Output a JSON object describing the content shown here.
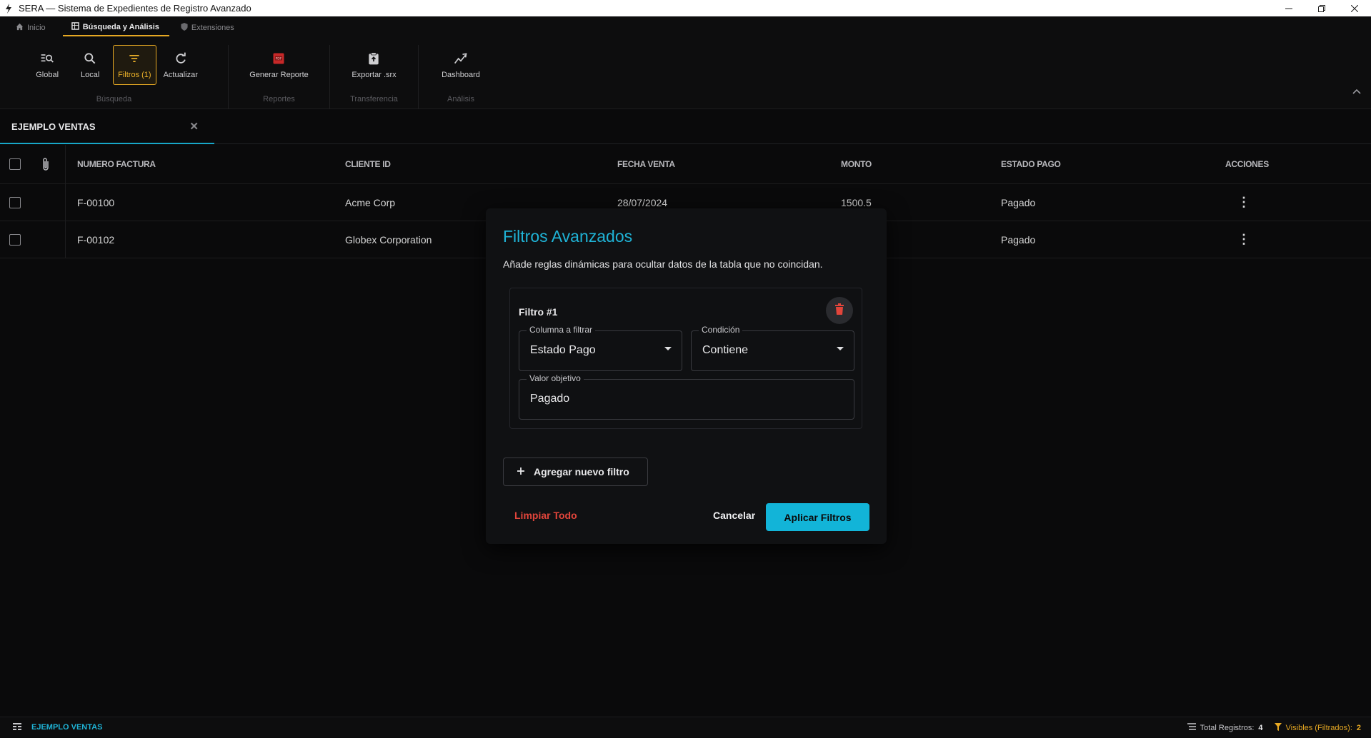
{
  "window": {
    "title": "SERA — Sistema de Expedientes de Registro Avanzado"
  },
  "ribbon": {
    "tabs": [
      {
        "label": "Inicio",
        "icon": "home-icon"
      },
      {
        "label": "Búsqueda y Análisis",
        "icon": "table-icon"
      },
      {
        "label": "Extensiones",
        "icon": "shield-icon"
      }
    ],
    "groups": {
      "busqueda": {
        "label": "Búsqueda",
        "buttons": [
          {
            "label": "Global",
            "icon": "global-search-icon"
          },
          {
            "label": "Local",
            "icon": "search-icon"
          },
          {
            "label": "Filtros (1)",
            "icon": "filter-icon"
          },
          {
            "label": "Actualizar",
            "icon": "refresh-icon"
          }
        ]
      },
      "reportes": {
        "label": "Reportes",
        "button": "Generar Reporte"
      },
      "transferencia": {
        "label": "Transferencia",
        "button": "Exportar .srx"
      },
      "analisis": {
        "label": "Análisis",
        "button": "Dashboard"
      }
    }
  },
  "document_tab": {
    "label": "EJEMPLO VENTAS"
  },
  "table": {
    "columns": [
      "NUMERO FACTURA",
      "CLIENTE ID",
      "FECHA VENTA",
      "MONTO",
      "ESTADO PAGO",
      "ACCIONES"
    ],
    "rows": [
      {
        "factura": "F-00100",
        "cliente": "Acme Corp",
        "fecha": "28/07/2024",
        "monto": "1500.5",
        "estado": "Pagado"
      },
      {
        "factura": "F-00102",
        "cliente": "Globex Corporation",
        "fecha": "",
        "monto": "",
        "estado": "Pagado"
      }
    ]
  },
  "dialog": {
    "title": "Filtros Avanzados",
    "subtitle": "Añade reglas dinámicas para ocultar datos de la tabla que no coincidan.",
    "filter": {
      "title": "Filtro #1",
      "column_label": "Columna a filtrar",
      "column_value": "Estado Pago",
      "condition_label": "Condición",
      "condition_value": "Contiene",
      "target_label": "Valor objetivo",
      "target_value": "Pagado"
    },
    "add_filter": "Agregar nuevo filtro",
    "clear_all": "Limpiar Todo",
    "cancel": "Cancelar",
    "apply": "Aplicar Filtros"
  },
  "statusbar": {
    "document": "EJEMPLO VENTAS",
    "total_label": "Total Registros:",
    "total_value": "4",
    "visible_label": "Visibles (Filtrados):",
    "visible_value": "2"
  },
  "colors": {
    "accent_cyan": "#12b4d8",
    "accent_amber": "#e6a823",
    "danger": "#e2453b"
  }
}
